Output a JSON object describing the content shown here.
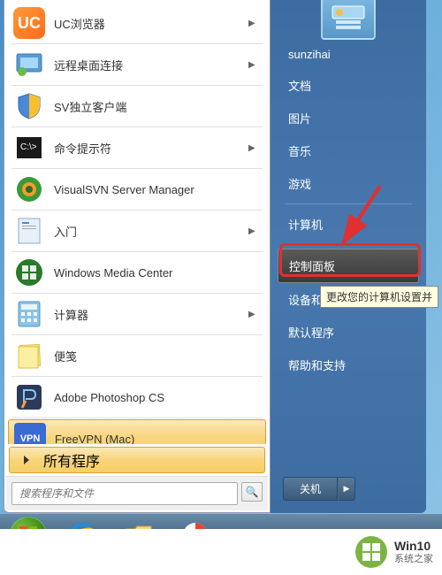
{
  "programs": [
    {
      "icon": "uc",
      "label": "UC浏览器",
      "arrow": true
    },
    {
      "icon": "rdp",
      "label": "远程桌面连接",
      "arrow": true
    },
    {
      "icon": "shield",
      "label": "SV独立客户端",
      "arrow": false
    },
    {
      "icon": "cmd",
      "label": "命令提示符",
      "arrow": true
    },
    {
      "icon": "vsvn",
      "label": "VisualSVN Server Manager",
      "arrow": false
    },
    {
      "icon": "intro",
      "label": "入门",
      "arrow": true
    },
    {
      "icon": "wmc",
      "label": "Windows Media Center",
      "arrow": false
    },
    {
      "icon": "calc",
      "label": "计算器",
      "arrow": true
    },
    {
      "icon": "notes",
      "label": "便笺",
      "arrow": false
    },
    {
      "icon": "ps",
      "label": "Adobe Photoshop CS",
      "arrow": false
    },
    {
      "icon": "vpn",
      "label": "FreeVPN (Mac)",
      "arrow": false,
      "selected": true
    }
  ],
  "all_programs_label": "所有程序",
  "search_placeholder": "搜索程序和文件",
  "right_items": [
    {
      "label": "sunzihai",
      "type": "item"
    },
    {
      "label": "文档",
      "type": "item"
    },
    {
      "label": "图片",
      "type": "item"
    },
    {
      "label": "音乐",
      "type": "item"
    },
    {
      "label": "游戏",
      "type": "item"
    },
    {
      "type": "divider"
    },
    {
      "label": "计算机",
      "type": "item"
    },
    {
      "type": "divider"
    },
    {
      "label": "控制面板",
      "type": "item",
      "highlighted": true
    },
    {
      "label": "设备和",
      "type": "item"
    },
    {
      "label": "默认程序",
      "type": "item"
    },
    {
      "label": "帮助和支持",
      "type": "item"
    }
  ],
  "tooltip_text": "更改您的计算机设置并",
  "shutdown_label": "关机",
  "watermark": {
    "main": "Win10",
    "sub": "系统之家"
  },
  "arrow_glyph": "▶",
  "search_icon": "🔍"
}
